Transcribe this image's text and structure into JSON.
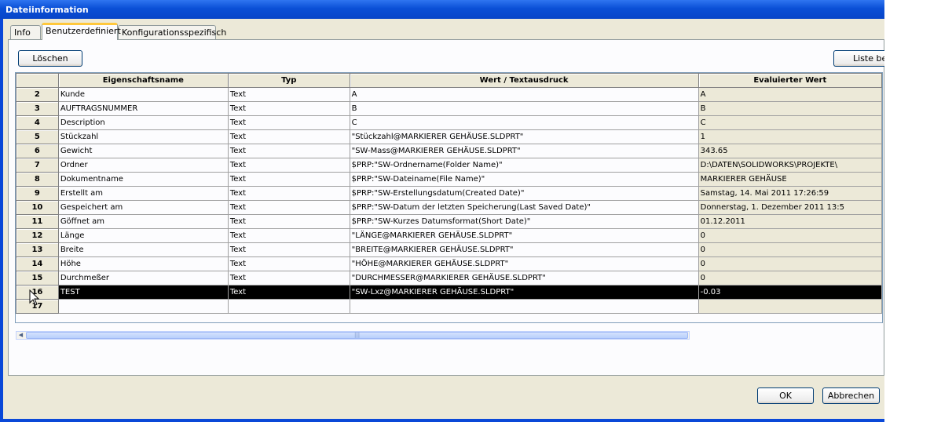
{
  "window": {
    "title": "Dateiinformation"
  },
  "tabs": [
    {
      "label": "Info"
    },
    {
      "label": "Benutzerdefiniert"
    },
    {
      "label": "Konfigurationsspezifisch"
    }
  ],
  "toolbar": {
    "delete_label": "Löschen",
    "list_label": "Liste bea"
  },
  "grid": {
    "columns": [
      "Eigenschaftsname",
      "Typ",
      "Wert / Textausdruck",
      "Evaluierter Wert"
    ],
    "rows": [
      {
        "num": "2",
        "name": "Kunde",
        "type": "Text",
        "value": "A",
        "evaluated": "A"
      },
      {
        "num": "3",
        "name": "AUFTRAGSNUMMER",
        "type": "Text",
        "value": "B",
        "evaluated": "B"
      },
      {
        "num": "4",
        "name": "Description",
        "type": "Text",
        "value": "C",
        "evaluated": "C"
      },
      {
        "num": "5",
        "name": "Stückzahl",
        "type": "Text",
        "value": "\"Stückzahl@MARKIERER GEHÄUSE.SLDPRT\"",
        "evaluated": "1"
      },
      {
        "num": "6",
        "name": "Gewicht",
        "type": "Text",
        "value": "\"SW-Mass@MARKIERER GEHÄUSE.SLDPRT\"",
        "evaluated": "343.65"
      },
      {
        "num": "7",
        "name": "Ordner",
        "type": "Text",
        "value": "$PRP:\"SW-Ordnername(Folder Name)\"",
        "evaluated": "D:\\DATEN\\SOLIDWORKS\\PROJEKTE\\"
      },
      {
        "num": "8",
        "name": "Dokumentname",
        "type": "Text",
        "value": "$PRP:\"SW-Dateiname(File Name)\"",
        "evaluated": "MARKIERER GEHÄUSE"
      },
      {
        "num": "9",
        "name": "Erstellt am",
        "type": "Text",
        "value": "$PRP:\"SW-Erstellungsdatum(Created Date)\"",
        "evaluated": "Samstag, 14. Mai 2011 17:26:59"
      },
      {
        "num": "10",
        "name": "Gespeichert am",
        "type": "Text",
        "value": "$PRP:\"SW-Datum der letzten Speicherung(Last Saved Date)\"",
        "evaluated": "Donnerstag, 1. Dezember 2011 13:5"
      },
      {
        "num": "11",
        "name": "Göffnet am",
        "type": "Text",
        "value": "$PRP:\"SW-Kurzes Datumsformat(Short Date)\"",
        "evaluated": "01.12.2011"
      },
      {
        "num": "12",
        "name": "Länge",
        "type": "Text",
        "value": "\"LÄNGE@MARKIERER GEHÄUSE.SLDPRT\"",
        "evaluated": "0"
      },
      {
        "num": "13",
        "name": "Breite",
        "type": "Text",
        "value": "\"BREITE@MARKIERER GEHÄUSE.SLDPRT\"",
        "evaluated": "0"
      },
      {
        "num": "14",
        "name": "Höhe",
        "type": "Text",
        "value": "\"HÖHE@MARKIERER GEHÄUSE.SLDPRT\"",
        "evaluated": "0"
      },
      {
        "num": "15",
        "name": "Durchmeßer",
        "type": "Text",
        "value": "\"DURCHMESSER@MARKIERER GEHÄUSE.SLDPRT\"",
        "evaluated": "0"
      },
      {
        "num": "16",
        "name": "TEST",
        "type": "Text",
        "value": "\"SW-Lxz@MARKIERER GEHÄUSE.SLDPRT\"",
        "evaluated": "-0.03"
      },
      {
        "num": "17",
        "name": "",
        "type": "",
        "value": "",
        "evaluated": ""
      }
    ]
  },
  "selected_row": "16",
  "footer": {
    "ok_label": "OK",
    "cancel_label": "Abbrechen"
  },
  "icons": {
    "cursor": "mouse-pointer-icon",
    "scroll_left": "scroll-left-arrow-icon"
  },
  "colors": {
    "titlebar": "#0a4fd6",
    "dialog_bg": "#ece9d8",
    "selection": "#000000",
    "tab_highlight": "#ffc83c"
  }
}
